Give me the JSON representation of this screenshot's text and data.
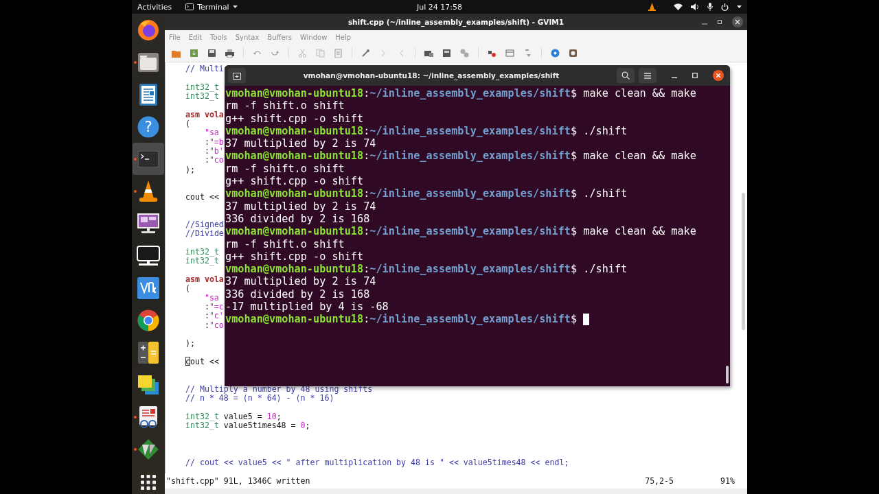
{
  "top_bar": {
    "activities": "Activities",
    "app_menu": "Terminal",
    "clock": "Jul 24  17:58"
  },
  "dock": {
    "items": [
      {
        "kind": "browser",
        "running": false,
        "selected": false
      },
      {
        "kind": "folder",
        "running": true,
        "selected": false
      },
      {
        "kind": "document",
        "running": false,
        "selected": false
      },
      {
        "kind": "help",
        "glyph": "?",
        "running": false,
        "selected": false
      },
      {
        "kind": "terminal",
        "running": true,
        "selected": true
      },
      {
        "kind": "cone",
        "running": true,
        "selected": false
      },
      {
        "kind": "screen",
        "running": false,
        "selected": false
      },
      {
        "kind": "monitor",
        "running": false,
        "selected": false
      },
      {
        "kind": "remote",
        "running": false,
        "selected": false
      },
      {
        "kind": "wheel",
        "running": false,
        "selected": false
      },
      {
        "kind": "calculator",
        "running": false,
        "selected": false
      },
      {
        "kind": "notes",
        "running": false,
        "selected": false
      },
      {
        "kind": "viewer",
        "running": true,
        "selected": false
      },
      {
        "kind": "editor",
        "running": true,
        "selected": false
      }
    ]
  },
  "gvim": {
    "title": "shift.cpp (~/inline_assembly_examples/shift) - GVIM1",
    "menu": [
      "File",
      "Edit",
      "Tools",
      "Syntax",
      "Buffers",
      "Window",
      "Help"
    ],
    "lines": [
      {
        "kind": "code",
        "cursor": false,
        "segments": [
          {
            "text": "// Multi",
            "kind": "comment"
          }
        ]
      },
      {
        "kind": "blank"
      },
      {
        "kind": "code",
        "cursor": false,
        "segments": [
          {
            "text": "int32_t",
            "kind": "type"
          }
        ]
      },
      {
        "kind": "code",
        "cursor": false,
        "segments": [
          {
            "text": "int32_t",
            "kind": "type"
          }
        ]
      },
      {
        "kind": "blank"
      },
      {
        "kind": "code",
        "cursor": false,
        "segments": [
          {
            "text": "asm vola",
            "kind": "keyword"
          }
        ]
      },
      {
        "kind": "code",
        "cursor": false,
        "segments": [
          {
            "text": "(",
            "kind": "plain"
          }
        ],
        "children": [
          {
            "kind": "code",
            "cursor": false,
            "segments": [
              {
                "text": "\"sa",
                "kind": "string"
              }
            ]
          },
          {
            "kind": "code",
            "cursor": false,
            "segments": [
              {
                "text": ":",
                "kind": "plain"
              },
              {
                "text": "\"=b",
                "kind": "string"
              }
            ]
          },
          {
            "kind": "code",
            "cursor": false,
            "segments": [
              {
                "text": ":",
                "kind": "plain"
              },
              {
                "text": "\"b'",
                "kind": "string"
              }
            ]
          },
          {
            "kind": "code",
            "cursor": false,
            "segments": [
              {
                "text": ":",
                "kind": "plain"
              },
              {
                "text": "\"co",
                "kind": "string"
              }
            ]
          }
        ]
      },
      {
        "kind": "code",
        "cursor": false,
        "segments": [
          {
            "text": ");",
            "kind": "plain"
          }
        ]
      },
      {
        "kind": "blank"
      },
      {
        "kind": "blank"
      },
      {
        "kind": "code",
        "cursor": false,
        "segments": [
          {
            "text": "cout <<",
            "kind": "plain"
          }
        ]
      },
      {
        "kind": "blank"
      },
      {
        "kind": "blank"
      },
      {
        "kind": "code",
        "cursor": false,
        "segments": [
          {
            "text": "//Signed",
            "kind": "comment"
          }
        ]
      },
      {
        "kind": "code",
        "cursor": false,
        "segments": [
          {
            "text": "//Divide",
            "kind": "comment"
          }
        ]
      },
      {
        "kind": "blank"
      },
      {
        "kind": "code",
        "cursor": false,
        "segments": [
          {
            "text": "int32_t",
            "kind": "type"
          }
        ]
      },
      {
        "kind": "code",
        "cursor": false,
        "segments": [
          {
            "text": "int32_t",
            "kind": "type"
          }
        ]
      },
      {
        "kind": "blank"
      },
      {
        "kind": "code",
        "cursor": false,
        "segments": [
          {
            "text": "asm vola",
            "kind": "keyword"
          }
        ]
      },
      {
        "kind": "code",
        "cursor": false,
        "segments": [
          {
            "text": "(",
            "kind": "plain"
          }
        ],
        "children": [
          {
            "kind": "code",
            "cursor": false,
            "segments": [
              {
                "text": "\"sa",
                "kind": "string"
              }
            ]
          },
          {
            "kind": "code",
            "cursor": false,
            "segments": [
              {
                "text": ":",
                "kind": "plain"
              },
              {
                "text": "\"=c",
                "kind": "string"
              }
            ]
          },
          {
            "kind": "code",
            "cursor": false,
            "segments": [
              {
                "text": ":",
                "kind": "plain"
              },
              {
                "text": "\"c'",
                "kind": "string"
              }
            ]
          },
          {
            "kind": "code",
            "cursor": false,
            "segments": [
              {
                "text": ":",
                "kind": "plain"
              },
              {
                "text": "\"co",
                "kind": "string"
              }
            ]
          },
          {
            "kind": "blank"
          }
        ]
      },
      {
        "kind": "code",
        "cursor": false,
        "segments": [
          {
            "text": ");",
            "kind": "plain"
          }
        ]
      },
      {
        "kind": "blank"
      },
      {
        "kind": "code",
        "cursor": true,
        "segments": [
          {
            "text": "cout <<",
            "kind": "plain"
          }
        ]
      },
      {
        "kind": "blank"
      },
      {
        "kind": "blank"
      },
      {
        "kind": "code",
        "cursor": false,
        "segments": [
          {
            "text": "// Multiply a number by 48 using shifts",
            "kind": "comment"
          }
        ]
      },
      {
        "kind": "code",
        "cursor": false,
        "segments": [
          {
            "text": "// n * 48 = (n * 64) - (n * 16)",
            "kind": "comment"
          }
        ]
      },
      {
        "kind": "blank"
      },
      {
        "kind": "code",
        "cursor": false,
        "segments": [
          {
            "text": "int32_t",
            "kind": "type"
          },
          {
            "text": " value5 = ",
            "kind": "plain"
          },
          {
            "text": "10",
            "kind": "number"
          },
          {
            "text": ";",
            "kind": "plain"
          }
        ]
      },
      {
        "kind": "code",
        "cursor": false,
        "segments": [
          {
            "text": "int32_t",
            "kind": "type"
          },
          {
            "text": " value5times48 = ",
            "kind": "plain"
          },
          {
            "text": "0",
            "kind": "number"
          },
          {
            "text": ";",
            "kind": "plain"
          }
        ]
      },
      {
        "kind": "blank"
      },
      {
        "kind": "blank"
      },
      {
        "kind": "blank"
      },
      {
        "kind": "code",
        "cursor": false,
        "segments": [
          {
            "text": "// cout << value5 << \" after multiplication by 48 is \" << value5times48 << endl;",
            "kind": "comment"
          }
        ]
      }
    ],
    "status": {
      "message": "\"shift.cpp\" 91L, 1346C written",
      "position": "75,2-5",
      "percent": "91%"
    }
  },
  "terminal": {
    "title": "vmohan@vmohan-ubuntu18: ~/inline_assembly_examples/shift",
    "lines": [
      {
        "kind": "prompt",
        "user": "vmohan@vmohan-ubuntu18",
        "sep": ":",
        "path": "~/inline_assembly_examples/shift",
        "end": "$",
        "command": "make clean && make",
        "cursor": false
      },
      {
        "kind": "output",
        "text": "rm -f shift.o shift"
      },
      {
        "kind": "output",
        "text": "g++ shift.cpp -o shift"
      },
      {
        "kind": "prompt",
        "user": "vmohan@vmohan-ubuntu18",
        "sep": ":",
        "path": "~/inline_assembly_examples/shift",
        "end": "$",
        "command": "./shift",
        "cursor": false
      },
      {
        "kind": "output",
        "text": "37 multiplied by 2 is 74"
      },
      {
        "kind": "prompt",
        "user": "vmohan@vmohan-ubuntu18",
        "sep": ":",
        "path": "~/inline_assembly_examples/shift",
        "end": "$",
        "command": "make clean && make",
        "cursor": false
      },
      {
        "kind": "output",
        "text": "rm -f shift.o shift"
      },
      {
        "kind": "output",
        "text": "g++ shift.cpp -o shift"
      },
      {
        "kind": "prompt",
        "user": "vmohan@vmohan-ubuntu18",
        "sep": ":",
        "path": "~/inline_assembly_examples/shift",
        "end": "$",
        "command": "./shift",
        "cursor": false
      },
      {
        "kind": "output",
        "text": "37 multiplied by 2 is 74"
      },
      {
        "kind": "output",
        "text": "336 divided by 2 is 168"
      },
      {
        "kind": "prompt",
        "user": "vmohan@vmohan-ubuntu18",
        "sep": ":",
        "path": "~/inline_assembly_examples/shift",
        "end": "$",
        "command": "make clean && make",
        "cursor": false
      },
      {
        "kind": "output",
        "text": "rm -f shift.o shift"
      },
      {
        "kind": "output",
        "text": "g++ shift.cpp -o shift"
      },
      {
        "kind": "prompt",
        "user": "vmohan@vmohan-ubuntu18",
        "sep": ":",
        "path": "~/inline_assembly_examples/shift",
        "end": "$",
        "command": "./shift",
        "cursor": false
      },
      {
        "kind": "output",
        "text": "37 multiplied by 2 is 74"
      },
      {
        "kind": "output",
        "text": "336 divided by 2 is 168"
      },
      {
        "kind": "output",
        "text": "-17 multiplied by 4 is -68"
      },
      {
        "kind": "prompt",
        "user": "vmohan@vmohan-ubuntu18",
        "sep": ":",
        "path": "~/inline_assembly_examples/shift",
        "end": "$",
        "cursor": true
      }
    ]
  }
}
